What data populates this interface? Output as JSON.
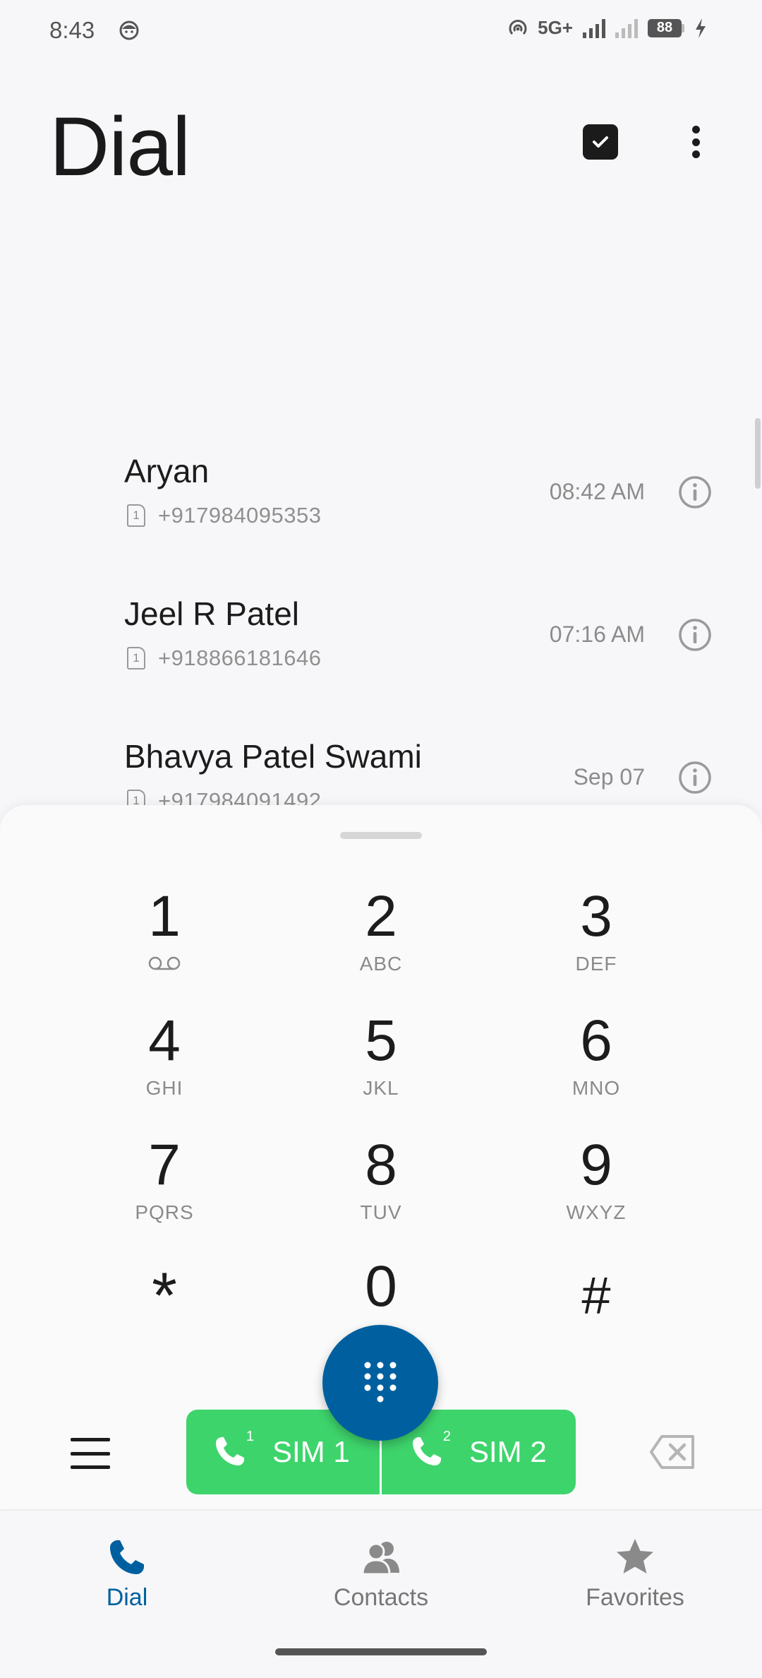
{
  "status_bar": {
    "time": "8:43",
    "network": "5G+",
    "battery": "88"
  },
  "header": {
    "title": "Dial"
  },
  "call_log": [
    {
      "name": "Aryan",
      "sim": "1",
      "number": "+917984095353",
      "time": "08:42 AM"
    },
    {
      "name": "Jeel R Patel",
      "sim": "1",
      "number": "+918866181646",
      "time": "07:16 AM"
    },
    {
      "name": "Bhavya Patel Swami",
      "sim": "1",
      "number": "+917984091492",
      "time": "Sep 07"
    }
  ],
  "dialpad": {
    "keys": [
      {
        "digit": "1",
        "letters": ""
      },
      {
        "digit": "2",
        "letters": "ABC"
      },
      {
        "digit": "3",
        "letters": "DEF"
      },
      {
        "digit": "4",
        "letters": "GHI"
      },
      {
        "digit": "5",
        "letters": "JKL"
      },
      {
        "digit": "6",
        "letters": "MNO"
      },
      {
        "digit": "7",
        "letters": "PQRS"
      },
      {
        "digit": "8",
        "letters": "TUV"
      },
      {
        "digit": "9",
        "letters": "WXYZ"
      },
      {
        "digit": "*",
        "letters": ""
      },
      {
        "digit": "0",
        "letters": "+"
      },
      {
        "digit": "#",
        "letters": ""
      }
    ]
  },
  "call_buttons": {
    "sim1_label": "SIM 1",
    "sim1_badge": "1",
    "sim2_label": "SIM 2",
    "sim2_badge": "2"
  },
  "bottom_nav": {
    "items": [
      {
        "label": "Dial",
        "icon": "phone-icon",
        "active": true
      },
      {
        "label": "Contacts",
        "icon": "contacts-icon",
        "active": false
      },
      {
        "label": "Favorites",
        "icon": "star-icon",
        "active": false
      }
    ]
  },
  "colors": {
    "accent": "#00609f",
    "call_green": "#3ed46c",
    "background": "#f7f7f9"
  }
}
